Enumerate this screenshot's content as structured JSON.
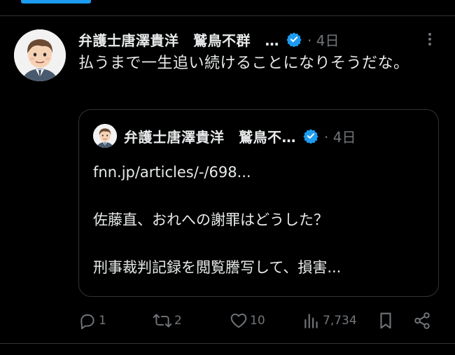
{
  "tweet": {
    "author_name": "弁護士唐澤貴洋　鷲鳥不群　…",
    "time": "· 4日",
    "text": "払うまで一生追い続けることになりそうだな。",
    "stats": {
      "replies": "1",
      "reposts": "2",
      "likes": "10",
      "views": "7,734"
    }
  },
  "quote": {
    "author_name": "弁護士唐澤貴洋　鷲鳥不…",
    "time": "· 4日",
    "lines": [
      "fnn.jp/articles/-/698...",
      "佐藤直、おれへの謝罪はどうした？",
      "刑事裁判記録を閲覧謄写して、損害..."
    ]
  },
  "colors": {
    "accent": "#1d9bf0",
    "text_primary": "#e7e9ea",
    "text_secondary": "#71767b",
    "border": "#2f3336",
    "background": "#000000"
  },
  "icons": [
    "verified-badge-icon",
    "more-icon",
    "reply-icon",
    "repost-icon",
    "like-icon",
    "views-icon",
    "bookmark-icon",
    "share-icon"
  ]
}
